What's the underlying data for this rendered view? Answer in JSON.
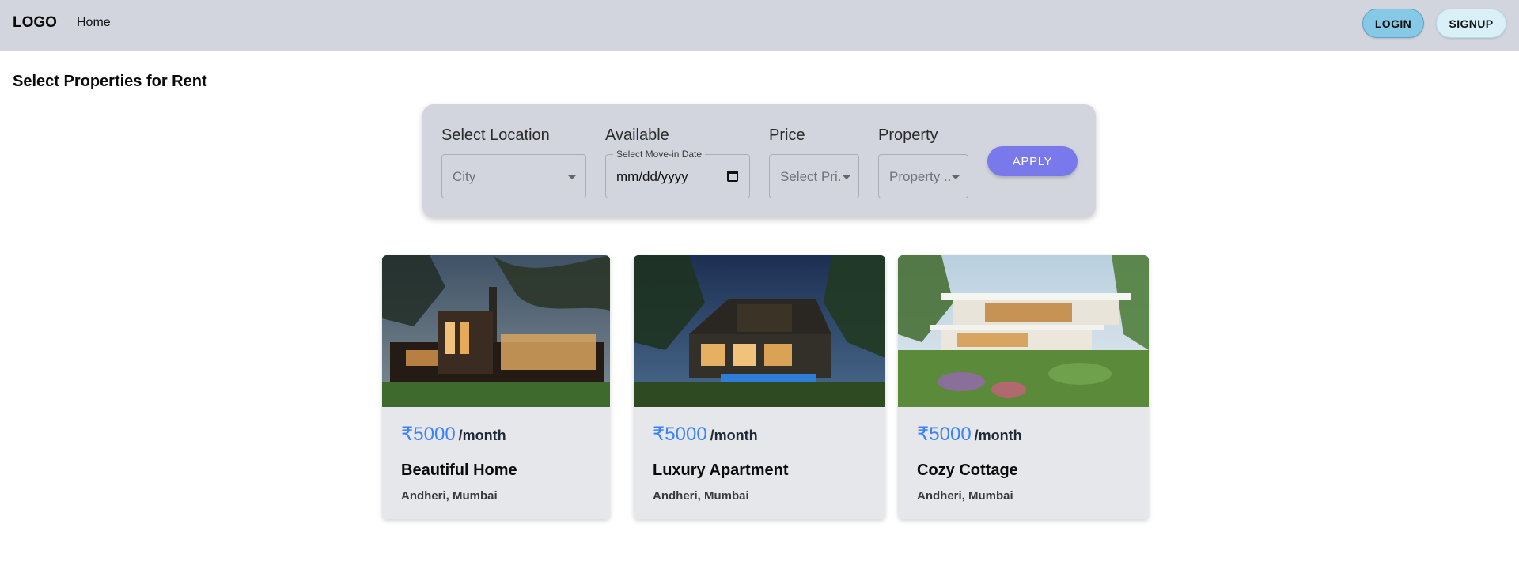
{
  "header": {
    "logo": "LOGO",
    "nav_home": "Home",
    "login_label": "LOGIN",
    "signup_label": "SIGNUP"
  },
  "page": {
    "title": "Select Properties for Rent"
  },
  "filters": {
    "location": {
      "label": "Select Location",
      "placeholder": "City"
    },
    "available": {
      "label": "Available",
      "float_label": "Select Move-in Date",
      "value": "mm/dd/yyyy"
    },
    "price": {
      "label": "Price",
      "placeholder": "Select Pri.."
    },
    "property": {
      "label": "Property",
      "placeholder": "Property .."
    },
    "apply_label": "APPLY"
  },
  "listings": [
    {
      "price": "₹5000",
      "period": "/month",
      "title": "Beautiful Home",
      "location": "Andheri, Mumbai"
    },
    {
      "price": "₹5000",
      "period": "/month",
      "title": "Luxury Apartment",
      "location": "Andheri, Mumbai"
    },
    {
      "price": "₹5000",
      "period": "/month",
      "title": "Cozy Cottage",
      "location": "Andheri, Mumbai"
    }
  ],
  "colors": {
    "header_bg": "#d2d5dd",
    "apply_button": "#7a79ec",
    "price_text": "#3b82f6",
    "login_button": "#86c9e6",
    "signup_button": "#d9f0f8"
  }
}
